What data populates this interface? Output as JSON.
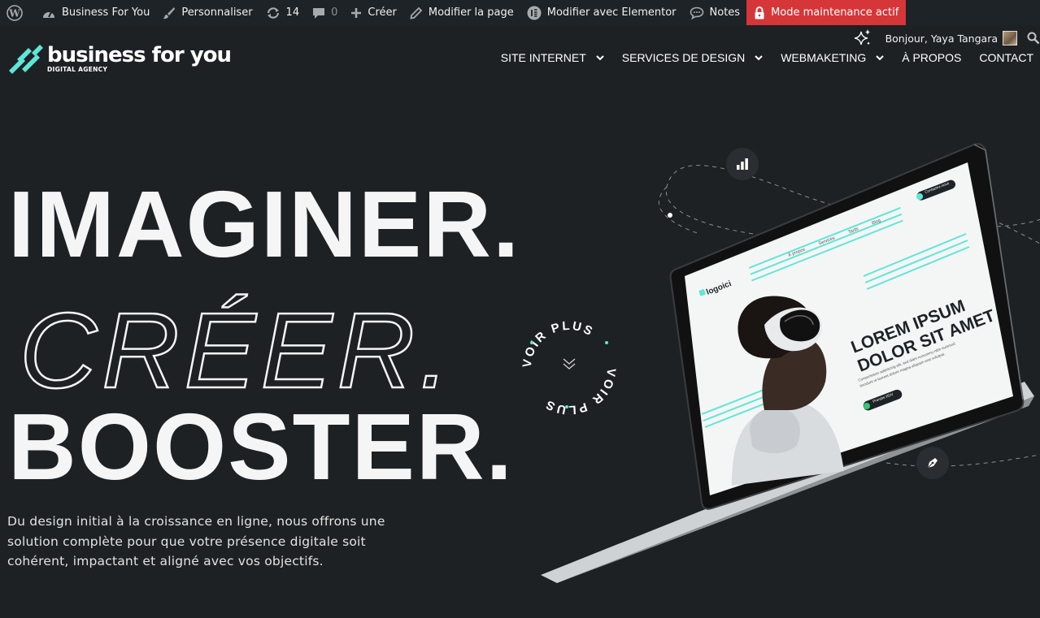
{
  "adminbar": {
    "site_name": "Business For You",
    "customize": "Personnaliser",
    "updates_count": "14",
    "comments_count": "0",
    "new": "Créer",
    "edit_page": "Modifier la page",
    "edit_elementor": "Modifier avec Elementor",
    "notes": "Notes",
    "maintenance": "Mode maintenance actif"
  },
  "account": {
    "greeting": "Bonjour, Yaya Tangara"
  },
  "header": {
    "brand_name": "business for you",
    "brand_sub": "DIGITAL AGENCY",
    "nav": [
      {
        "label": "SITE INTERNET",
        "has_dropdown": true
      },
      {
        "label": "SERVICES DE DESIGN",
        "has_dropdown": true
      },
      {
        "label": "WEBMAKETING",
        "has_dropdown": true
      },
      {
        "label": "À PROPOS",
        "has_dropdown": false
      },
      {
        "label": "CONTACT",
        "has_dropdown": false
      }
    ]
  },
  "hero": {
    "line1": "IMAGINER.",
    "line2": "CRÉER.",
    "line3": "BOOSTER.",
    "intro": "Du design initial à la croissance en ligne, nous offrons une solution complète pour que votre présence digitale soit cohérent, impactant et aligné avec vos objectifs.",
    "voir_plus": "VOIR PLUS"
  },
  "mockup": {
    "logo": "logoici",
    "nav": [
      "À propos",
      "Services",
      "Tarifs",
      "Blog"
    ],
    "contact_button": "Contactez-nous",
    "headline_1": "LOREM IPSUM",
    "headline_2": "DOLOR SIT AMET",
    "body_1": "Consectetuer adipiscing elit, sed diam nonummy nibh euismod",
    "body_2": "tincidunt ut laoreet dolore magna aliquam erat volutpat.",
    "cta": "Prendre RDV"
  },
  "colors": {
    "background": "#1e2124",
    "adminbar": "#1d2327",
    "maintenance": "#d63638",
    "accent_teal": "#5ee6d6",
    "accent_green": "#2ecc71"
  }
}
